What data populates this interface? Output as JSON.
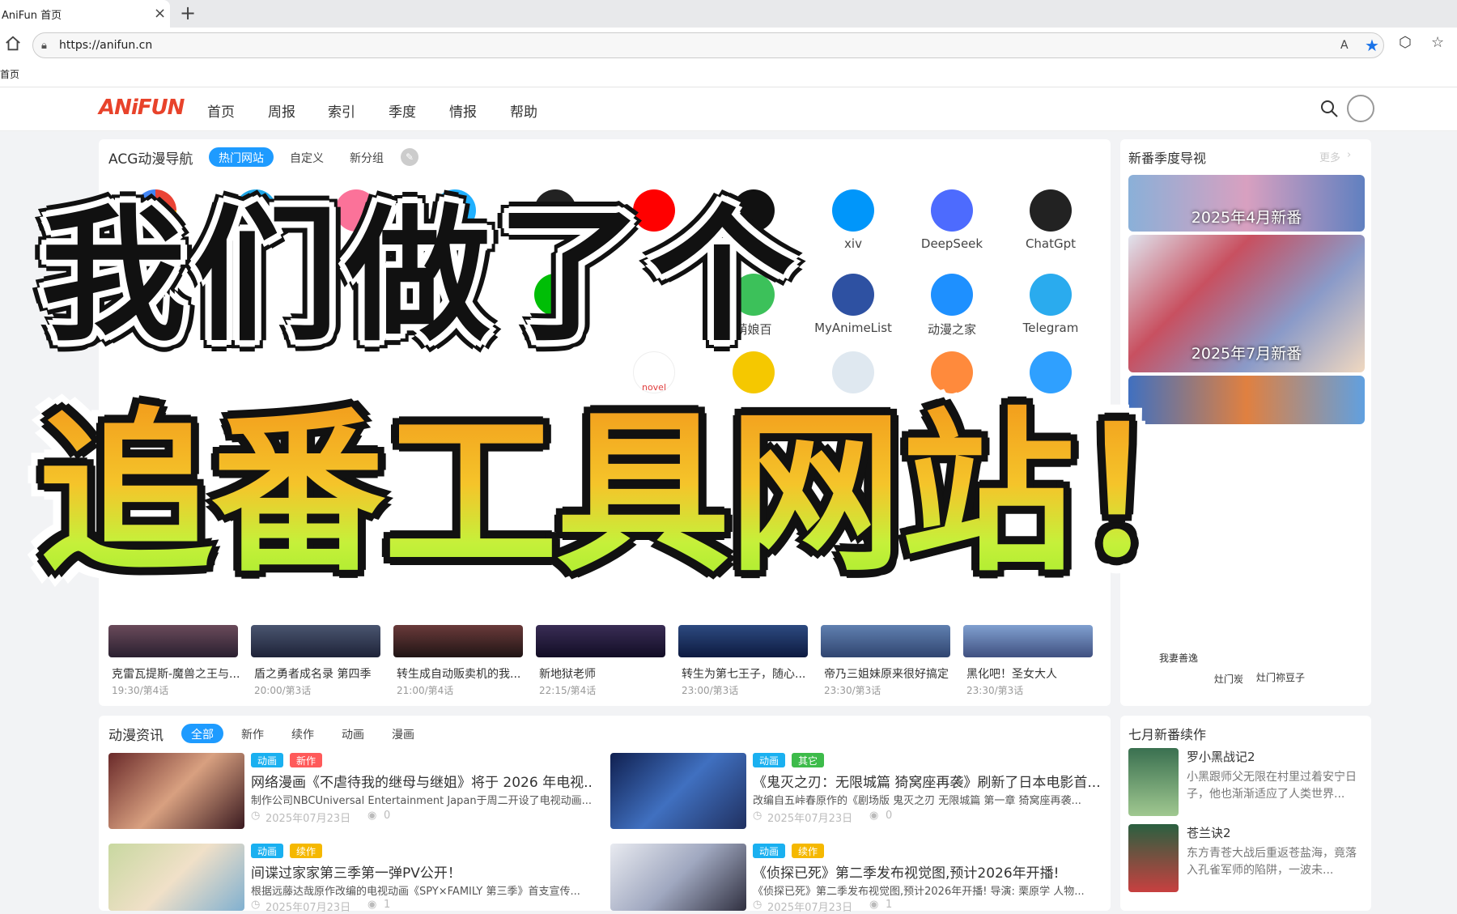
{
  "browser": {
    "tab_title": "AniFun 首页",
    "tab_close": "×",
    "new_tab": "+",
    "url": "https://anifun.cn",
    "bookmark": "首页",
    "read_aloud": "A"
  },
  "site": {
    "logo": "ANiFUN",
    "nav": [
      "首页",
      "周报",
      "索引",
      "季度",
      "情报",
      "帮助"
    ]
  },
  "nav_section": {
    "title": "ACG动漫导航",
    "tabs": [
      "热门网站",
      "自定义",
      "新分组"
    ],
    "sites": [
      {
        "label": "DeepSeek",
        "color": "#4d6bfe",
        "icon": "deepseek-icon"
      },
      {
        "label": "ChatGpt",
        "color": "#222222",
        "icon": "chatgpt-icon"
      },
      {
        "label": "xiv",
        "color": "#0096fa",
        "icon": "pixiv-icon"
      },
      {
        "label": "爱奇",
        "color": "#00be06",
        "icon": "iqiyi-icon"
      },
      {
        "label": "萌娘百",
        "color": "#3cc15a",
        "icon": "moegirl-icon"
      },
      {
        "label": "MyAnimeList",
        "color": "#2e51a2",
        "icon": "myanimelist-icon"
      },
      {
        "label": "动漫之家",
        "color": "#1e90ff",
        "icon": "dmzj-icon"
      },
      {
        "label": "Telegram",
        "color": "#2aabee",
        "icon": "telegram-icon"
      },
      {
        "label": "novel",
        "color": "#e03c3c",
        "icon": "novel-icon"
      }
    ]
  },
  "schedule": [
    {
      "title": "克雷瓦提斯-魔兽之王与...",
      "time": "19:30/第4话"
    },
    {
      "title": "盾之勇者成名录 第四季",
      "time": "20:00/第3话"
    },
    {
      "title": "转生成自动贩卖机的我...",
      "time": "21:00/第4话"
    },
    {
      "title": "新地狱老师",
      "time": "22:15/第4话"
    },
    {
      "title": "转生为第七王子，随心...",
      "time": "23:00/第3话"
    },
    {
      "title": "帝乃三姐妹原来很好搞定",
      "time": "23:30/第3话"
    },
    {
      "title": "黑化吧！圣女大人",
      "time": "23:30/第3话"
    }
  ],
  "season_guide": {
    "title": "新番季度导视",
    "more": "更多",
    "banners": [
      "2025年4月新番",
      "2025年7月新番"
    ],
    "users": [
      "我妻善逸",
      "灶门炭",
      "灶门祢豆子"
    ]
  },
  "news": {
    "title": "动漫资讯",
    "tabs": [
      "全部",
      "新作",
      "续作",
      "动画",
      "漫画"
    ],
    "items": [
      {
        "tags": [
          "动画",
          "新作"
        ],
        "title": "网络漫画《不虐待我的继母与继姐》将于 2026 年电视...",
        "desc": "制作公司NBCUniversal Entertainment Japan于周二开设了电视动画...",
        "date": "2025年07月23日",
        "views": "0"
      },
      {
        "tags": [
          "动画",
          "其它"
        ],
        "title": "《鬼灭之刃：无限城篇 猗窝座再袭》刷新了日本电影首...",
        "desc": "改编自五峠春原作的《剧场版 鬼灭之刃 无限城篇 第一章 猗窝座再袭...",
        "date": "2025年07月23日",
        "views": "0"
      },
      {
        "tags": [
          "动画",
          "续作"
        ],
        "title": "间谍过家家第三季第一弹PV公开！",
        "desc": "根据远藤达哉原作改编的电视动画《SPY×FAMILY 第三季》首支宣传...",
        "date": "2025年07月23日",
        "views": "1"
      },
      {
        "tags": [
          "动画",
          "续作"
        ],
        "title": "《侦探已死》第二季发布视觉图,预计2026年开播!",
        "desc": "《侦探已死》第二季发布视觉图,预计2026年开播! 导演: 栗原学 人物...",
        "date": "2025年07月23日",
        "views": "1"
      }
    ]
  },
  "sequels": {
    "title": "七月新番续作",
    "items": [
      {
        "title": "罗小黑战记2",
        "desc": "小黑跟师父无限在村里过着安宁日子，他也渐渐适应了人类世界..."
      },
      {
        "title": "苍兰诀2",
        "desc": "东方青苍大战后重返苍盐海，竟落入孔雀军师的陷阱，一波未..."
      }
    ]
  },
  "overlay": {
    "line1": "我们做了个",
    "line2": "追番工具网站！"
  },
  "colors": {
    "accent": "#1e9bff",
    "tag_anim": "#1ab0f0",
    "tag_new": "#ff5a5a",
    "tag_other": "#3dbb4a",
    "tag_seq": "#f5b800",
    "logo": "#e8432b"
  }
}
